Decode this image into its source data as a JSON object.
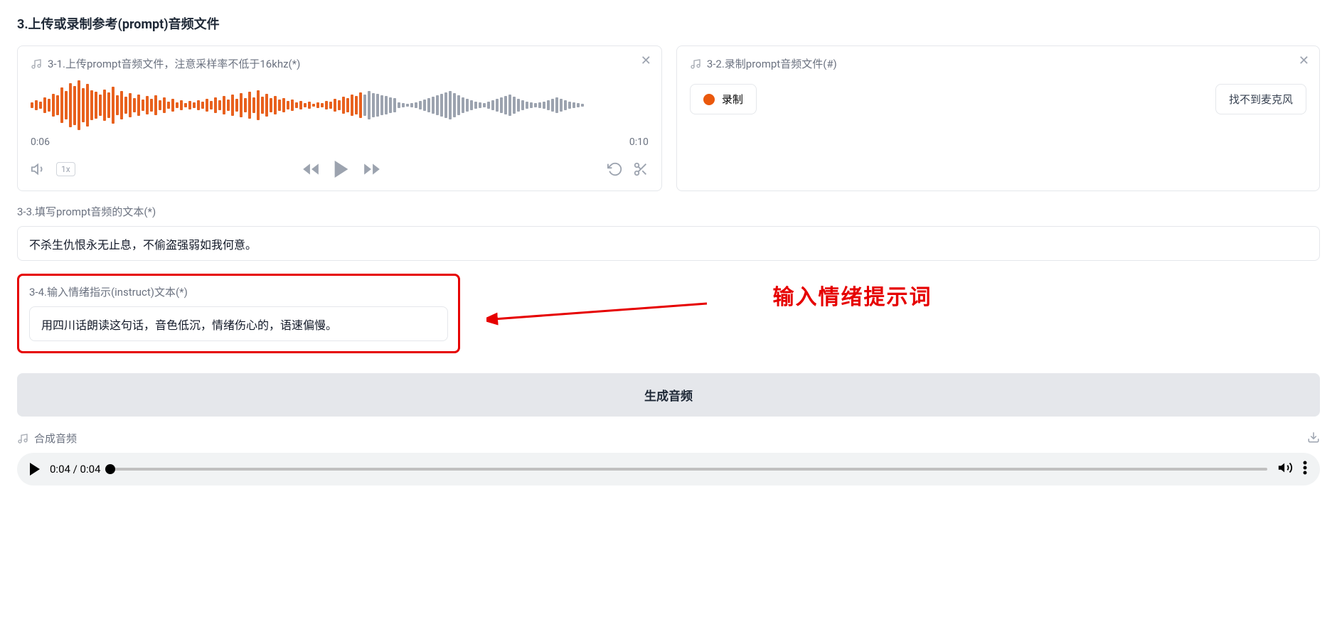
{
  "section_title": "3.上传或录制参考(prompt)音频文件",
  "upload_card": {
    "header": "3-1.上传prompt音频文件，注意采样率不低于16khz(*)",
    "time_current": "0:06",
    "time_total": "0:10",
    "speed": "1x"
  },
  "record_card": {
    "header": "3-2.录制prompt音频文件(#)",
    "record_label": "录制",
    "nomic_label": "找不到麦克风"
  },
  "field_prompt_text": {
    "label": "3-3.填写prompt音频的文本(*)",
    "value": "不杀生仇恨永无止息，不偷盗强弱如我何意。"
  },
  "field_instruct": {
    "label": "3-4.输入情绪指示(instruct)文本(*)",
    "value": "用四川话朗读这句话，音色低沉，情绪伤心的，语速偏慢。"
  },
  "annotation": "输入情绪提示词",
  "generate_label": "生成音频",
  "synth": {
    "header": "合成音频",
    "time": "0:04 / 0:04"
  }
}
